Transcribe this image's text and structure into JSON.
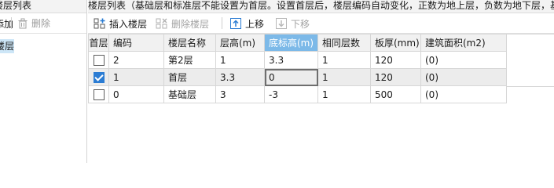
{
  "left_panel": {
    "title": "楼层列表",
    "toolbar": {
      "add_label": "添加",
      "delete_label": "删除"
    },
    "tree_item": "楼层"
  },
  "main": {
    "title": "楼层列表（基础层和标准层不能设置为首层。设置首层后，楼层编码自动变化，正数为地上层，负数为地下层，基",
    "toolbar": {
      "insert_label": "插入楼层",
      "delete_label": "删除楼层",
      "up_label": "上移",
      "down_label": "下移"
    },
    "columns": [
      "首层",
      "编码",
      "楼层名称",
      "层高(m)",
      "底标高(m)",
      "相同层数",
      "板厚(mm)",
      "建筑面积(m2)"
    ],
    "selected_column": "底标高(m)",
    "rows": [
      {
        "first_floor": false,
        "code": "2",
        "name": "第2层",
        "height": "1",
        "bottom_elev": "3.3",
        "same_count": "1",
        "slab": "120",
        "area": "(0)"
      },
      {
        "first_floor": true,
        "code": "1",
        "name": "首层",
        "height": "3.3",
        "bottom_elev": "0",
        "same_count": "1",
        "slab": "120",
        "area": "(0)"
      },
      {
        "first_floor": false,
        "code": "0",
        "name": "基础层",
        "height": "3",
        "bottom_elev": "-3",
        "same_count": "1",
        "slab": "500",
        "area": "(0)"
      }
    ]
  },
  "colors": {
    "accent": "#2b7cd3",
    "selected_header": "#7cb9e8",
    "selected_row": "#ececec",
    "tree_highlight": "#cde6f7"
  }
}
